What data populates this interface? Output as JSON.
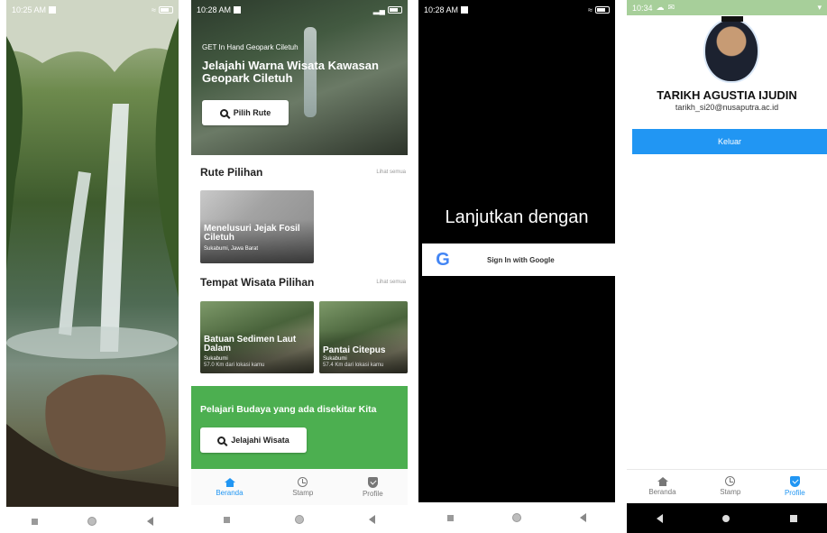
{
  "screen1": {
    "status": {
      "time": "10:25 AM"
    },
    "image": "waterfall-photo"
  },
  "screen2": {
    "status": {
      "time": "10:28 AM"
    },
    "hero": {
      "subtitle": "GET In Hand Geopark Ciletuh",
      "title": "Jelajahi Warna Wisata Kawasan Geopark Ciletuh",
      "button": "Pilih Rute"
    },
    "routes": {
      "heading": "Rute Pilihan",
      "see_all": "Lihat semua",
      "cards": [
        {
          "title": "Menelusuri Jejak Fosil Ciletuh",
          "location": "Sukabumi, Jawa Barat"
        }
      ]
    },
    "places": {
      "heading": "Tempat Wisata Pilihan",
      "see_all": "Lihat semua",
      "cards": [
        {
          "title": "Batuan Sedimen Laut Dalam",
          "location": "Sukabumi",
          "distance": "57.0 Km dari lokasi kamu"
        },
        {
          "title": "Pantai Citepus",
          "location": "Sukabumi",
          "distance": "57.4 Km dari lokasi kamu"
        }
      ]
    },
    "culture": {
      "text": "Pelajari Budaya yang ada disekitar Kita",
      "button": "Jelajahi Wisata"
    },
    "tabs": [
      {
        "label": "Beranda",
        "icon": "home-icon",
        "active": true
      },
      {
        "label": "Stamp",
        "icon": "history-icon",
        "active": false
      },
      {
        "label": "Profile",
        "icon": "shield-check-icon",
        "active": false
      }
    ]
  },
  "screen3": {
    "status": {
      "time": "10:28 AM"
    },
    "heading": "Lanjutkan dengan",
    "google_button": "Sign In with Google",
    "google_logo": "G"
  },
  "screen4": {
    "status": {
      "time": "10:34"
    },
    "name": "TARIKH AGUSTIA IJUDIN",
    "email": "tarikh_si20@nusaputra.ac.id",
    "logout": "Keluar",
    "tabs": [
      {
        "label": "Beranda",
        "icon": "home-icon",
        "active": false
      },
      {
        "label": "Stamp",
        "icon": "history-icon",
        "active": false
      },
      {
        "label": "Profile",
        "icon": "shield-check-icon",
        "active": true
      }
    ]
  },
  "colors": {
    "accent_blue": "#2196f3",
    "band_green": "#4caf50",
    "status_green": "#a7cf9a"
  }
}
